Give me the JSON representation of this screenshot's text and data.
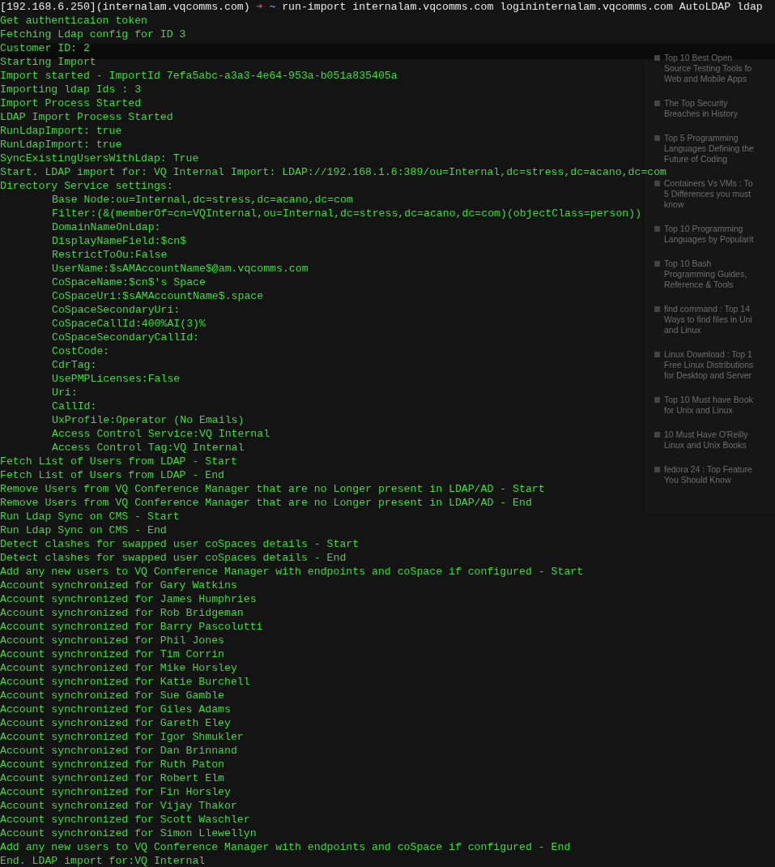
{
  "prompt": {
    "host": "[192.168.6.250](internalam.vqcomms.com)",
    "arrow": "➜",
    "cwd": "~",
    "command": "run-import internalam.vqcomms.com logininternalam.vqcomms.com AutoLDAP ldap"
  },
  "lines": [
    {
      "text": "Get authenticaion token"
    },
    {
      "text": "Fetching Ldap config for ID 3"
    },
    {
      "text": "Customer ID: 2"
    },
    {
      "text": "Starting Import"
    },
    {
      "text": "Import started - ImportId 7efa5abc-a3a3-4e64-953a-b051a835405a"
    },
    {
      "text": "Importing ldap Ids : 3"
    },
    {
      "text": "Import Process Started"
    },
    {
      "text": "LDAP Import Process Started"
    },
    {
      "text": "RunLdapImport: true"
    },
    {
      "text": "RunLdapImport: true"
    },
    {
      "text": "SyncExistingUsersWithLdap: True"
    },
    {
      "text": "Start. LDAP import for: VQ Internal Import: LDAP://192.168.1.6:389/ou=Internal,dc=stress,dc=acano,dc=com"
    },
    {
      "text": "Directory Service settings:",
      "children": [
        {
          "text": "Base Node:ou=Internal,dc=stress,dc=acano,dc=com"
        },
        {
          "text": "Filter:(&(memberOf=cn=VQInternal,ou=Internal,dc=stress,dc=acano,dc=com)(objectClass=person))"
        },
        {
          "text": "DomainNameOnLdap:"
        },
        {
          "text": "DisplayNameField:$cn$"
        },
        {
          "text": "RestrictToOu:False"
        },
        {
          "text": "UserName:$sAMAccountName$@am.vqcomms.com"
        },
        {
          "text": "CoSpaceName:$cn$'s Space"
        },
        {
          "text": "CoSpaceUri:$sAMAccountName$.space"
        },
        {
          "text": "CoSpaceSecondaryUri:"
        },
        {
          "text": "CoSpaceCallId:400%AI(3)%"
        },
        {
          "text": "CoSpaceSecondaryCallId:"
        },
        {
          "text": "CostCode:"
        },
        {
          "text": "CdrTag:"
        },
        {
          "text": "UsePMPLicenses:False"
        },
        {
          "text": "Uri:"
        },
        {
          "text": "CallId:"
        },
        {
          "text": "UxProfile:Operator (No Emails)"
        },
        {
          "text": "Access Control Service:VQ Internal"
        },
        {
          "text": "Access Control Tag:VQ Internal"
        }
      ]
    },
    {
      "text": "Fetch List of Users from LDAP - Start"
    },
    {
      "text": "Fetch List of Users from LDAP - End"
    },
    {
      "text": "Remove Users from VQ Conference Manager that are no Longer present in LDAP/AD - Start"
    },
    {
      "text": "Remove Users from VQ Conference Manager that are no Longer present in LDAP/AD - End"
    },
    {
      "text": "Run Ldap Sync on CMS - Start"
    },
    {
      "text": "Run Ldap Sync on CMS - End"
    },
    {
      "text": "Detect clashes for swapped user coSpaces details - Start"
    },
    {
      "text": "Detect clashes for swapped user coSpaces details - End"
    },
    {
      "text": "Add any new users to VQ Conference Manager with endpoints and coSpace if configured - Start"
    },
    {
      "text": "Account synchronized for Gary Watkins"
    },
    {
      "text": "Account synchronized for James Humphries"
    },
    {
      "text": "Account synchronized for Rob Bridgeman"
    },
    {
      "text": "Account synchronized for Barry Pascolutti"
    },
    {
      "text": "Account synchronized for Phil Jones"
    },
    {
      "text": "Account synchronized for Tim Corrin"
    },
    {
      "text": "Account synchronized for Mike Horsley"
    },
    {
      "text": "Account synchronized for Katie Burchell"
    },
    {
      "text": "Account synchronized for Sue Gamble"
    },
    {
      "text": "Account synchronized for Giles Adams"
    },
    {
      "text": "Account synchronized for Gareth Eley"
    },
    {
      "text": "Account synchronized for Igor Shmukler"
    },
    {
      "text": "Account synchronized for Dan Brinnand"
    },
    {
      "text": "Account synchronized for Ruth Paton"
    },
    {
      "text": "Account synchronized for Robert Elm"
    },
    {
      "text": "Account synchronized for Fin Horsley"
    },
    {
      "text": "Account synchronized for Vijay Thakor"
    },
    {
      "text": "Account synchronized for Scott Waschler"
    },
    {
      "text": "Account synchronized for Simon Llewellyn"
    },
    {
      "text": "Add any new users to VQ Conference Manager with endpoints and coSpace if configured - End"
    },
    {
      "text": "End. LDAP import for:VQ Internal"
    }
  ],
  "background_articles": [
    {
      "lines": [
        "Top 10 Best Open",
        "Source Testing Tools fo",
        "Web and Mobile Apps"
      ]
    },
    {
      "lines": [
        "The Top Security",
        "Breaches in History"
      ]
    },
    {
      "lines": [
        "Top 5 Programming",
        "Languages Defining the",
        "Future of Coding"
      ]
    },
    {
      "lines": [
        "Containers Vs VMs : To",
        "5 Differences you must",
        "know"
      ]
    },
    {
      "lines": [
        "Top 10 Programming",
        "Languages by Popularit"
      ]
    },
    {
      "lines": [
        "Top 10 Bash",
        "Programming Guides,",
        "Reference & Tools"
      ]
    },
    {
      "lines": [
        "find command : Top 14",
        "Ways to find files in Uni",
        "and Linux"
      ]
    },
    {
      "lines": [
        "Linux Download : Top 1",
        "Free Linux Distributions",
        "for Desktop and Server"
      ]
    },
    {
      "lines": [
        "Top 10 Must have Book",
        "for Unix and Linux"
      ]
    },
    {
      "lines": [
        "10 Must Have O'Reilly",
        "Linux and Unix Books"
      ]
    },
    {
      "lines": [
        "fedora 24 : Top Feature",
        "You Should Know"
      ]
    }
  ]
}
